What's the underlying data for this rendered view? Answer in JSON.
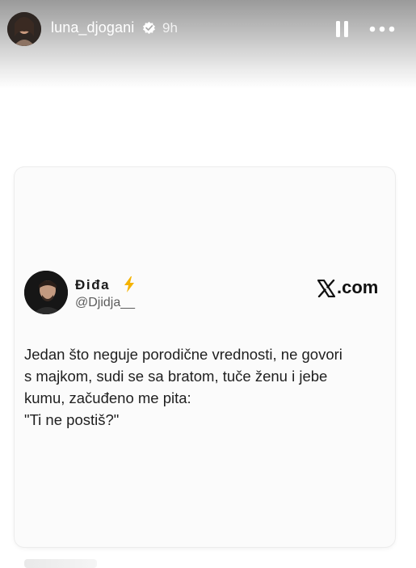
{
  "story": {
    "username": "luna_djogani",
    "time": "9h",
    "verified": true,
    "icons": {
      "verified": "verified-badge-icon",
      "pause": "pause-icon",
      "more": "more-horizontal-icon"
    }
  },
  "tweet": {
    "author_name": "Điđa",
    "author_handle": "@Djidja__",
    "source": ".com",
    "badge_icon": "lightning-bolt-icon",
    "lines": [
      "Jedan što neguje porodične vrednosti, ne govori",
      "s majkom, sudi se sa bratom, tuče ženu i jebe",
      "kumu, začuđeno me pita:",
      "\"Ti ne postiš?\""
    ]
  },
  "colors": {
    "bolt": "#f5b301",
    "verified": "#ffffff",
    "card_bg": "#fbfbfb"
  }
}
